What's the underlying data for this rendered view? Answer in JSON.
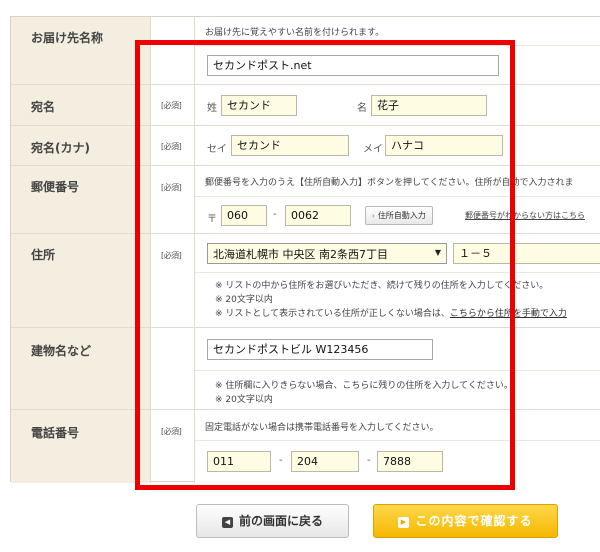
{
  "rows": {
    "name_label": {
      "label": "お届け先名称",
      "hint": "お届け先に覚えやすい名前を付けられます。",
      "value": "セカンドポスト.net"
    },
    "recipient": {
      "label": "宛名",
      "required": "[必須]",
      "sei_label": "姓",
      "sei_value": "セカンド",
      "mei_label": "名",
      "mei_value": "花子"
    },
    "recipient_kana": {
      "label": "宛名(カナ)",
      "required": "[必須]",
      "sei_label": "セイ",
      "sei_value": "セカンド",
      "mei_label": "メイ",
      "mei_value": "ハナコ"
    },
    "postal": {
      "label": "郵便番号",
      "required": "[必須]",
      "hint": "郵便番号を入力のうえ【住所自動入力】ボタンを押してください。住所が自動で入力されま",
      "mark": "〒",
      "part1": "060",
      "dash": "-",
      "part2": "0062",
      "auto_button": "住所自動入力",
      "unknown_link": "郵便番号がわからない方はこちら"
    },
    "address": {
      "label": "住所",
      "required": "[必須]",
      "select_value": "北海道札幌市 中央区 南2条西7丁目",
      "extra_value": "１－５",
      "note1": "※ リストの中から住所をお選びいただき、続けて残りの住所を入力してください。",
      "note2": "※ 20文字以内",
      "note3_prefix": "※ リストとして表示されている住所が正しくない場合は、",
      "note3_link": "こちらから住所を手動で入力"
    },
    "building": {
      "label": "建物名など",
      "value": "セカンドポストビル W123456",
      "note1": "※ 住所欄に入りきらない場合、こちらに残りの住所を入力してください。",
      "note2": "※ 20文字以内"
    },
    "phone": {
      "label": "電話番号",
      "required": "[必須]",
      "hint": "固定電話がない場合は携帯電話番号を入力してください。",
      "part1": "011",
      "part2": "204",
      "part3": "7888",
      "dash": "-"
    }
  },
  "buttons": {
    "back": "前の画面に戻る",
    "confirm": "この内容で確認する"
  },
  "colors": {
    "highlight_frame": "#ee0000",
    "header_bg": "#f3eedf",
    "input_bg": "#fefde3",
    "confirm_bg": "#f5b800"
  }
}
